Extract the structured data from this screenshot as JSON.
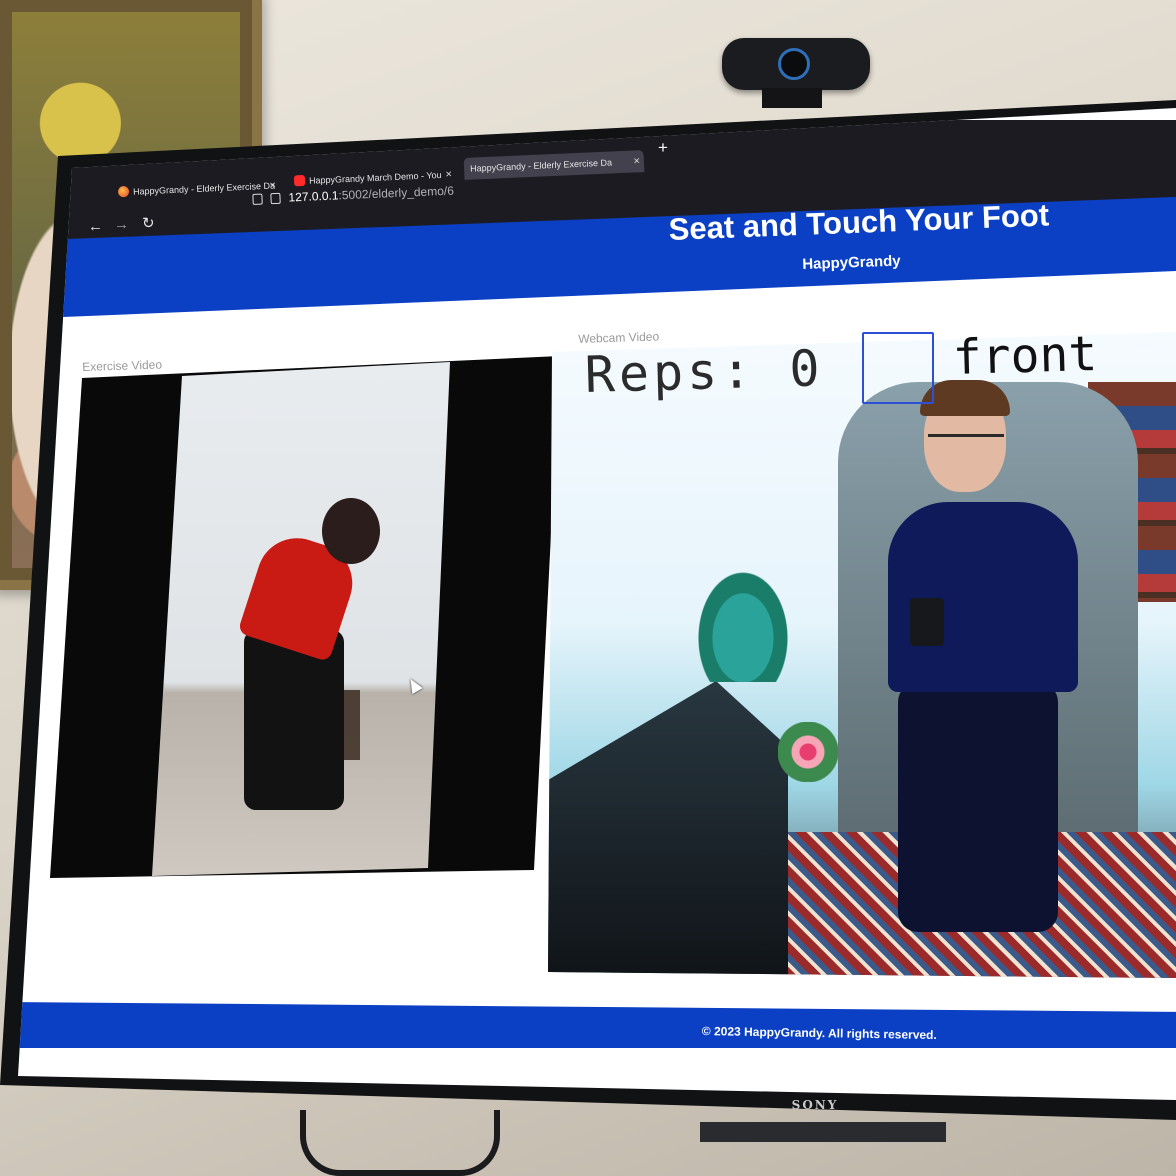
{
  "browser": {
    "tabs": [
      {
        "label": "HappyGrandy - Elderly Exercise Da",
        "icon": "firefox-icon",
        "active": false
      },
      {
        "label": "HappyGrandy March Demo - You",
        "icon": "youtube-icon",
        "active": false
      },
      {
        "label": "HappyGrandy - Elderly Exercise Da",
        "icon": "none",
        "active": true
      }
    ],
    "new_tab_label": "+",
    "close_glyph": "×",
    "url_host": "127.0.0.1",
    "url_path": ":5002/elderly_demo/6"
  },
  "header": {
    "title": "Seat and Touch Your Foot",
    "subtitle": "HappyGrandy",
    "color": "#0b40c4"
  },
  "main": {
    "exercise_video_label": "Exercise Video",
    "webcam_video_label": "Webcam Video",
    "webcam_overlay": {
      "reps_label": "Reps:",
      "reps_value": "0",
      "pose_label": "front"
    }
  },
  "footer": {
    "text": "© 2023 HappyGrandy. All rights reserved."
  },
  "device": {
    "brand": "SONY"
  }
}
